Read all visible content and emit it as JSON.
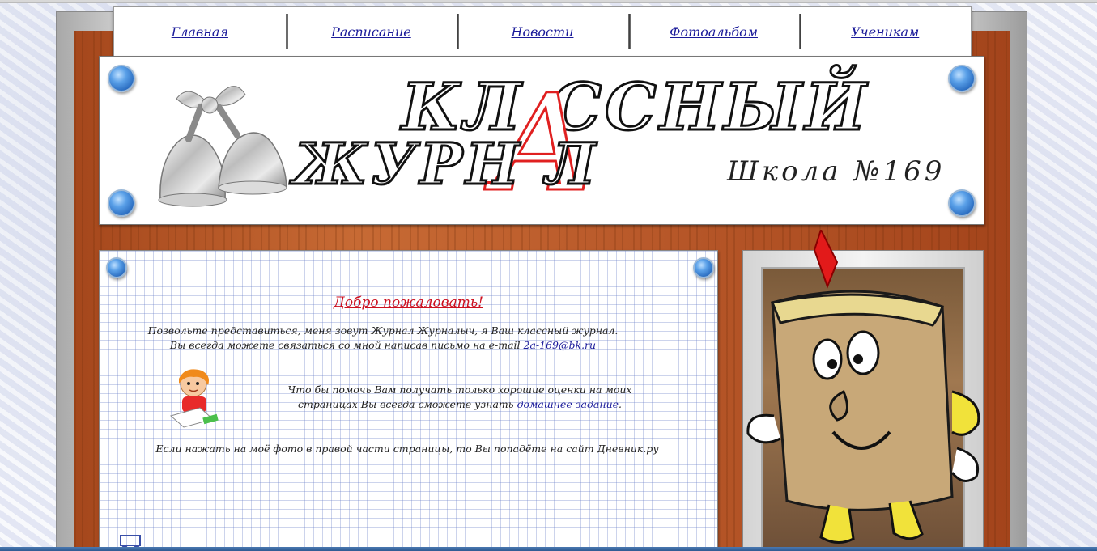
{
  "nav": {
    "items": [
      {
        "label": "Главная"
      },
      {
        "label": "Расписание"
      },
      {
        "label": "Новости"
      },
      {
        "label": "Фотоальбом"
      },
      {
        "label": "Ученикам"
      }
    ]
  },
  "header": {
    "title_line1": "КЛ ССНЫЙ",
    "title_letter": "А",
    "title_line2": "ЖУРН Л",
    "school": "Школа №169"
  },
  "main": {
    "welcome": "Добро пожаловать!",
    "intro_line1": "Позвольте представиться, меня зовут Журнал Журналыч, я Ваш классный журнал.",
    "intro_line2_prefix": "Вы всегда можете связаться со мной написав письмо на e-mail",
    "email": "2a-169@bk.ru",
    "homework_text": "Что бы помочь Вам получать только хорошие оценки на моих страницах Вы всегда сможете узнать",
    "homework_link": "домашнее задание",
    "homework_suffix": ".",
    "photo_note": "Если нажать на моё фото в правой части страницы, то Вы попадёте на сайт Дневник.ру"
  },
  "colors": {
    "link": "#1b1b9a",
    "welcome": "#cc1020",
    "wood": "#b9592a",
    "pin": "#2a6cc0"
  }
}
